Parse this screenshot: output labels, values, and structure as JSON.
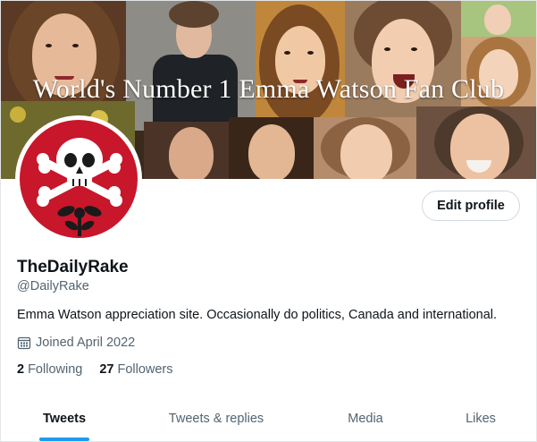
{
  "banner": {
    "title": "World's Number 1 Emma Watson Fan Club"
  },
  "profile": {
    "display_name": "TheDailyRake",
    "handle": "@DailyRake",
    "bio": "Emma Watson appreciation site. Occasionally do politics, Canada and international.",
    "joined": "Joined April 2022",
    "following_count": "2",
    "following_label": "Following",
    "followers_count": "27",
    "followers_label": "Followers",
    "edit_button": "Edit profile",
    "avatar_icon": "skull-crossbones-icon",
    "avatar_color": "#c8162b"
  },
  "tabs": [
    {
      "label": "Tweets",
      "active": true
    },
    {
      "label": "Tweets & replies",
      "active": false
    },
    {
      "label": "Media",
      "active": false
    },
    {
      "label": "Likes",
      "active": false
    }
  ],
  "colors": {
    "accent": "#1d9bf0",
    "text": "#0f1419",
    "secondary_text": "#536471"
  }
}
